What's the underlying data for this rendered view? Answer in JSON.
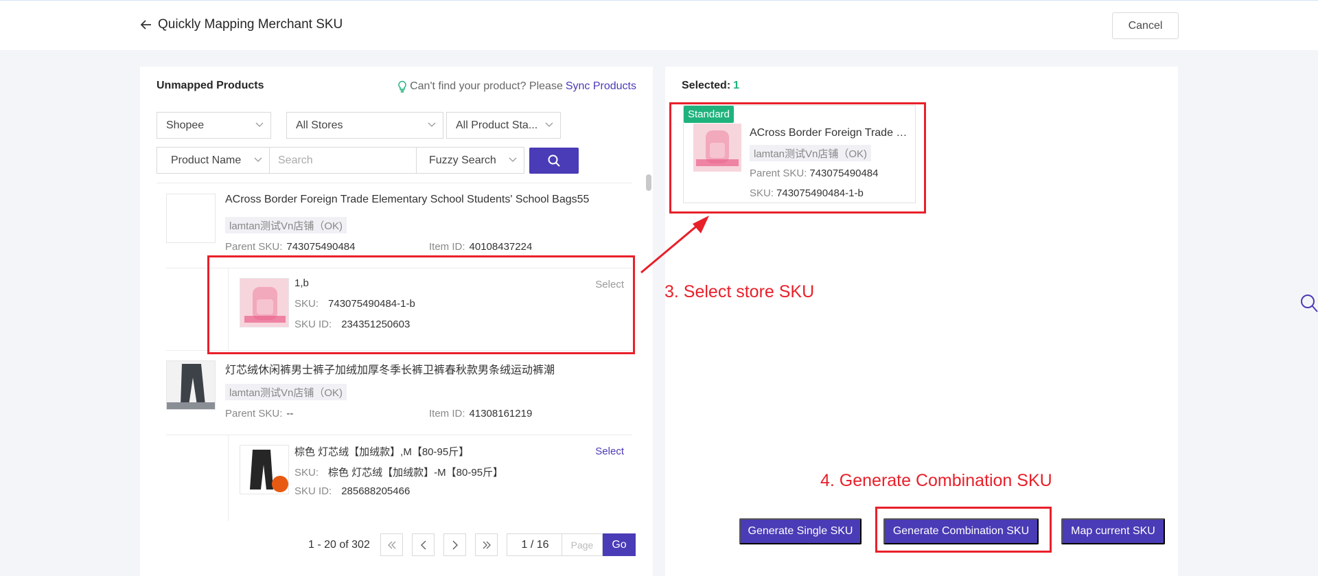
{
  "header": {
    "title": "Quickly Mapping Merchant SKU",
    "cancel_label": "Cancel"
  },
  "left": {
    "title": "Unmapped Products",
    "help_text": "Can't find your product? Please",
    "help_link": "Sync Products",
    "filters": {
      "platform": "Shopee",
      "stores": "All Stores",
      "status": "All Product Sta...",
      "field": "Product Name",
      "search_placeholder": "Search",
      "mode": "Fuzzy Search"
    },
    "products": [
      {
        "name": "ACross Border Foreign Trade Elementary School Students' School Bags55",
        "store": "lamtan测试Vn店铺（OK)",
        "parent_sku_label": "Parent SKU:",
        "parent_sku": "743075490484",
        "item_id_label": "Item ID:",
        "item_id": "40108437224",
        "variant": {
          "name": "1,b",
          "sku_label": "SKU:",
          "sku": "743075490484-1-b",
          "sku_id_label": "SKU ID:",
          "sku_id": "234351250603",
          "action": "Select"
        }
      },
      {
        "name": "灯芯绒休闲裤男士裤子加绒加厚冬季长裤卫裤春秋款男条绒运动裤潮",
        "store": "lamtan测试Vn店铺（OK)",
        "parent_sku_label": "Parent SKU:",
        "parent_sku": "--",
        "item_id_label": "Item ID:",
        "item_id": "41308161219",
        "variant": {
          "name": "棕色 灯芯绒【加绒款】,M【80-95斤】",
          "sku_label": "SKU:",
          "sku": "棕色 灯芯绒【加绒款】-M【80-95斤】",
          "sku_id_label": "SKU ID:",
          "sku_id": "285688205466",
          "action": "Select"
        }
      }
    ],
    "pagination": {
      "total": "1 - 20 of 302",
      "current": "1 / 16",
      "page_placeholder": "Page",
      "go_label": "Go"
    }
  },
  "right": {
    "selected_label": "Selected:",
    "selected_count": "1",
    "card": {
      "badge": "Standard",
      "name": "ACross Border Foreign Trade El...",
      "store": "lamtan测试Vn店铺（OK)",
      "parent_sku_label": "Parent SKU:",
      "parent_sku": "743075490484",
      "sku_label": "SKU:",
      "sku": "743075490484-1-b"
    },
    "buttons": {
      "single": "Generate Single SKU",
      "combination": "Generate Combination SKU",
      "map": "Map current SKU"
    }
  },
  "annotations": {
    "step3": "3. Select store SKU",
    "step4": "4. Generate Combination SKU"
  },
  "colors": {
    "brand": "#4a3bb6",
    "accent_green": "#1fb27c",
    "annotation_red": "#e8202a"
  }
}
